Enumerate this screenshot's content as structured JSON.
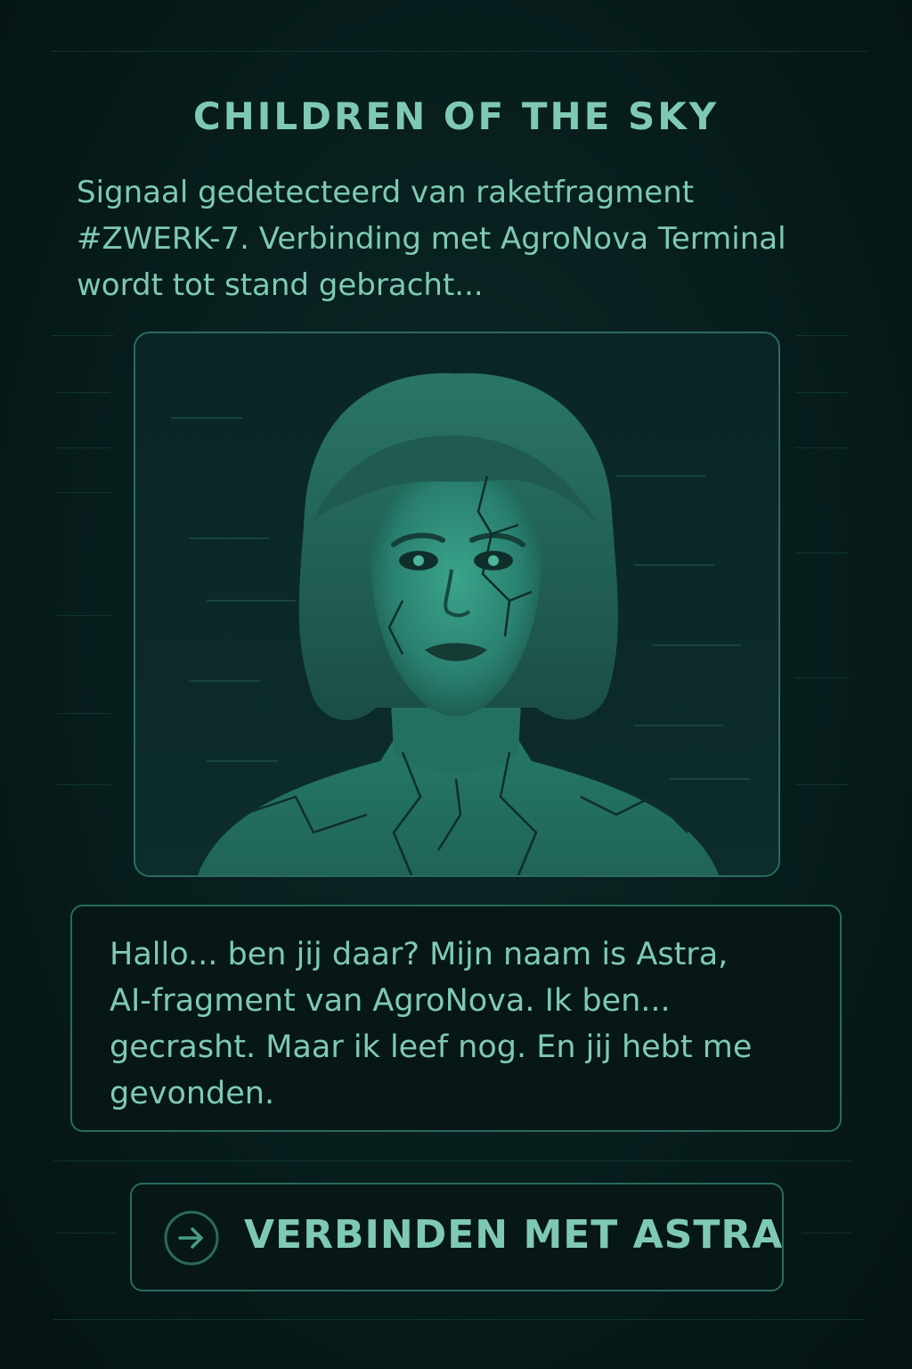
{
  "header": {
    "title": "CHILDREN OF THE SKY"
  },
  "intro": {
    "lines": [
      "Signaal gedetecteerd van raketfragment",
      "#ZWERK-7. Verbinding met AgroNova Terminal",
      "wordt tot stand gebracht..."
    ]
  },
  "portrait": {
    "icon": "astra-portrait-image"
  },
  "message": {
    "lines": [
      "Hallo... ben jij daar? Mijn naam is Astra,",
      "AI-fragment van AgroNova. Ik ben...",
      "gecrasht. Maar ik leef nog. En jij hebt me",
      "gevonden."
    ]
  },
  "action": {
    "label": "VERBINDEN MET ASTRA",
    "icon": "arrow-right-circle-icon"
  },
  "colors": {
    "background": "#061a1a",
    "text": "#7fc9b4",
    "border": "#2b6a60",
    "portrait_teal": "#2f8f7a"
  }
}
